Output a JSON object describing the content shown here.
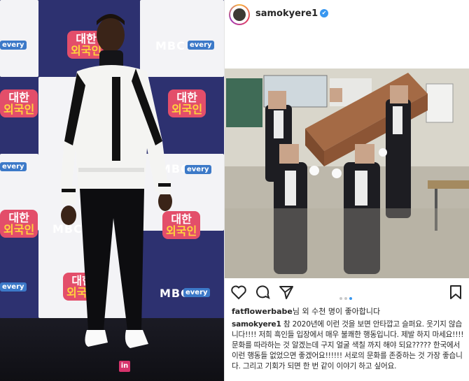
{
  "backdrop": {
    "network_logo": "MBC",
    "channel_logo": "every",
    "show_logo_line1": "대한",
    "show_logo_line2": "외국인",
    "watermark_letter": "in"
  },
  "post": {
    "username": "samokyere1",
    "verified_glyph": "✔",
    "liked_by_user": "fatflowerbabe",
    "likes_text": "님 외 수천 명이 좋아합니다",
    "caption_user": "samokyere1",
    "caption_text": " 참 2020년에 이런 것을 보면 안타깝고 슬퍼요. 웃기지 않습니다!!!! 저희 흑인들 입장에서 매우 불쾌한 행동입니다. 제발 하지 마세요!!!! 문화를 따라하는 것 알겠는데 구지 얼굴 색칠 까지 해야 되요????? 한국에서 이런 행동들 없었으면 좋겠어요!!!!!! 서로의 문화를 존중하는 것 가장 좋습니다. 그리고 기회가 되면 한 번 같이 이야기 하고 싶어요."
  },
  "colors": {
    "verified_blue": "#3897f0",
    "backdrop_navy": "#2b2f66",
    "logo_pink": "#e34e6a"
  },
  "icons": [
    "heart-icon",
    "comment-icon",
    "share-icon",
    "bookmark-icon"
  ]
}
